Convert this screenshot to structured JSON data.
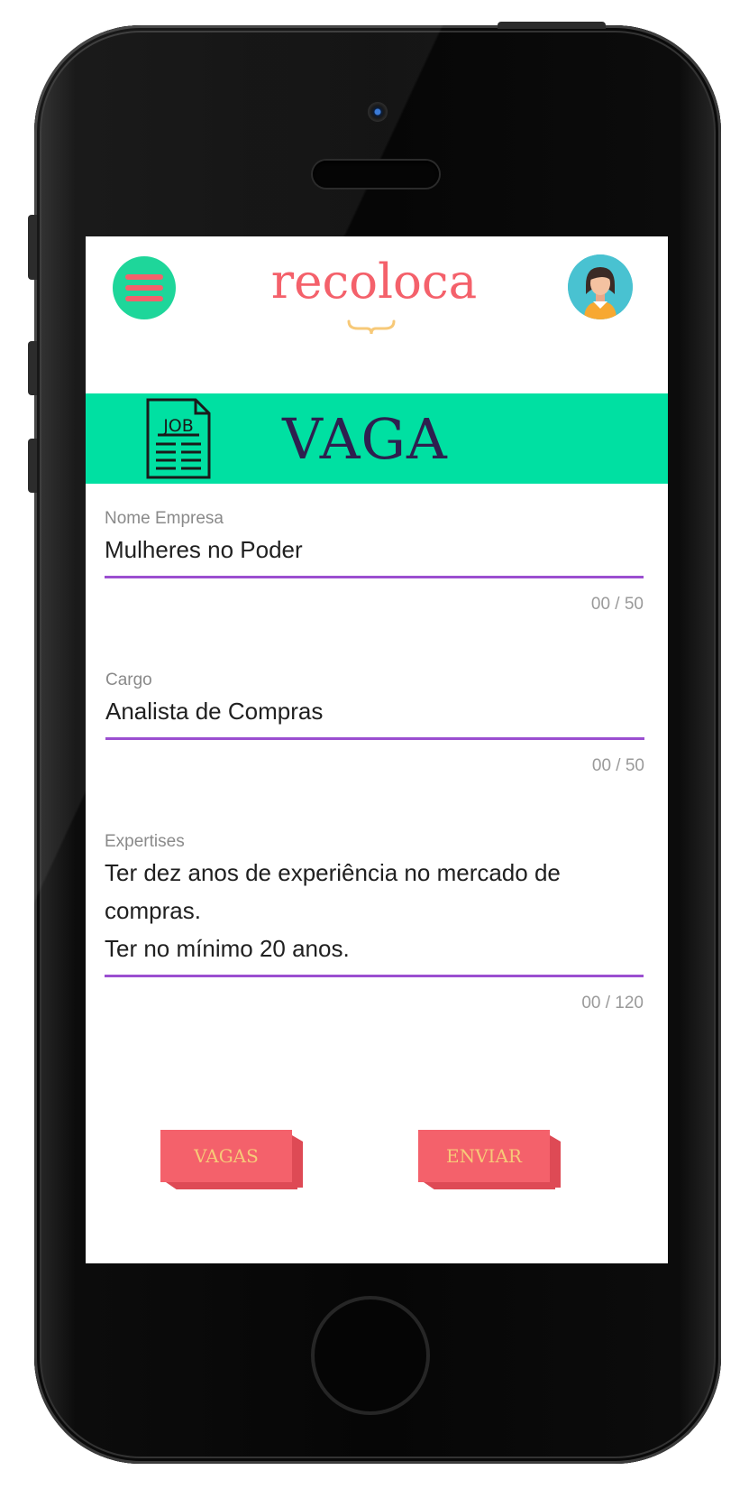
{
  "app": {
    "logo": "recoloca"
  },
  "banner": {
    "icon": "job-document-icon",
    "icon_text": "JOB",
    "title": "VAGA"
  },
  "form": {
    "company": {
      "label": "Nome Empresa",
      "value": "Mulheres no Poder",
      "counter": "00 / 50"
    },
    "role": {
      "label": "Cargo",
      "value": "Analista de Compras",
      "counter": "00 / 50"
    },
    "expertise": {
      "label": "Expertises",
      "value": "Ter dez anos de experiência no mercado de compras.\nTer no mínimo 20 anos.",
      "counter": "00 / 120"
    }
  },
  "actions": {
    "vagas_label": "VAGAS",
    "enviar_label": "ENVIAR"
  },
  "colors": {
    "accent_green": "#00e0a2",
    "accent_coral": "#f4616b",
    "underline_purple": "#9b4fd0",
    "title_navy": "#2e1f4f",
    "button_text": "#f7c978"
  }
}
